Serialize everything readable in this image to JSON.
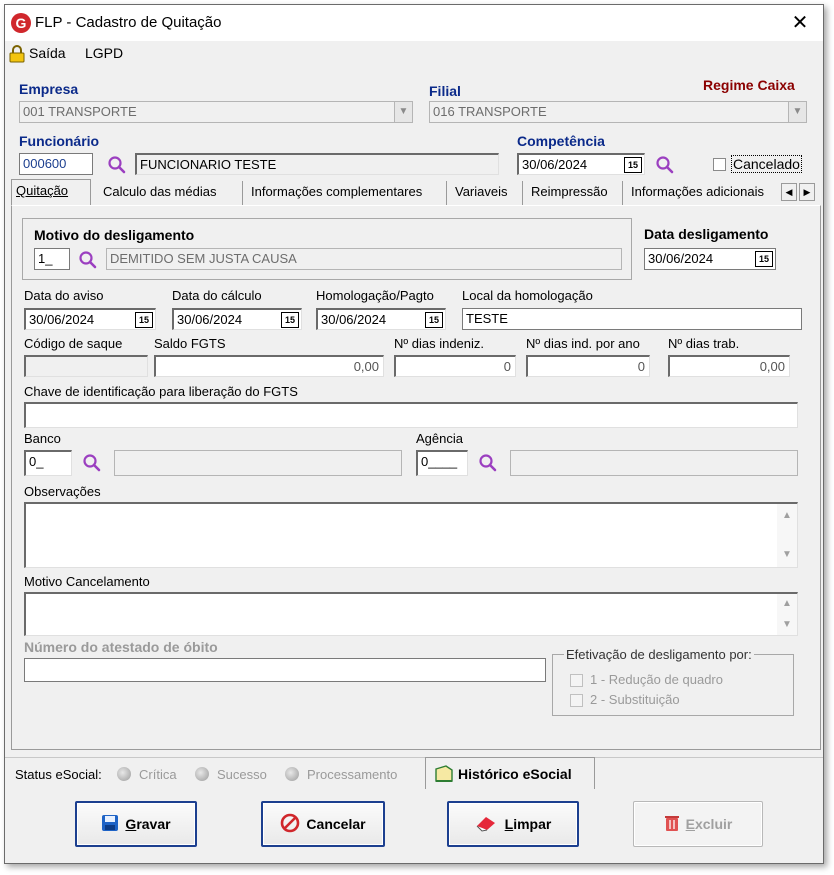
{
  "window": {
    "title": "FLP - Cadastro de Quitação",
    "logo_letter": "G",
    "close_glyph": "✕"
  },
  "menu": {
    "exit": "Saída",
    "lgpd": "LGPD"
  },
  "header": {
    "empresa_label": "Empresa",
    "empresa_value": "001 TRANSPORTE",
    "filial_label": "Filial",
    "filial_value": "016 TRANSPORTE",
    "regime_label": "Regime Caixa",
    "funcionario_label": "Funcionário",
    "funcionario_code": "000600",
    "funcionario_name": "FUNCIONARIO TESTE",
    "competencia_label": "Competência",
    "competencia_value": "30/06/2024",
    "cancelado_label": "Cancelado",
    "cancelado_checked": false
  },
  "tabs": [
    "Quitação",
    "Calculo das médias",
    "Informações complementares",
    "Variaveis",
    "Reimpressão",
    "Informações adicionais"
  ],
  "form": {
    "motivo_label": "Motivo do desligamento",
    "motivo_code": "1_",
    "motivo_desc": "DEMITIDO SEM JUSTA CAUSA",
    "data_deslig_label": "Data desligamento",
    "data_deslig_value": "30/06/2024",
    "data_aviso_label": "Data do aviso",
    "data_aviso_value": "30/06/2024",
    "data_calc_label": "Data do cálculo",
    "data_calc_value": "30/06/2024",
    "homolog_label": "Homologação/Pagto",
    "homolog_value": "30/06/2024",
    "local_homolog_label": "Local da homologação",
    "local_homolog_value": "TESTE",
    "cod_saque_label": "Código de saque",
    "cod_saque_value": "",
    "saldo_fgts_label": "Saldo FGTS",
    "saldo_fgts_value": "0,00",
    "dias_indeniz_label": "Nº dias indeniz.",
    "dias_indeniz_value": "0",
    "dias_ind_ano_label": "Nº dias ind. por ano",
    "dias_ind_ano_value": "0",
    "dias_trab_label": "Nº dias trab.",
    "dias_trab_value": "0,00",
    "chave_label": "Chave de identificação para liberação do FGTS",
    "chave_value": "",
    "banco_label": "Banco",
    "banco_code": "0_",
    "agencia_label": "Agência",
    "agencia_code": "0____",
    "observacoes_label": "Observações",
    "motivo_cancel_label": "Motivo Cancelamento",
    "atestado_label": "Número do atestado de óbito",
    "efetivacao_label": "Efetivação de desligamento por:",
    "opt1": "1 - Redução de quadro",
    "opt2": "2 - Substituição"
  },
  "status": {
    "label": "Status eSocial:",
    "critica": "Crítica",
    "sucesso": "Sucesso",
    "processamento": "Processamento",
    "historico": "Histórico eSocial"
  },
  "buttons": {
    "gravar_first": "G",
    "gravar_rest": "ravar",
    "cancelar": "Cancelar",
    "limpar_first": "L",
    "limpar_rest": "impar",
    "excluir_first": "E",
    "excluir_rest": "xcluir"
  },
  "calendar_glyph": "15",
  "colors": {
    "accent_blue": "#0b2a8a",
    "regime_red": "#8b0000",
    "search_purple": "#9b3fc0",
    "logo_red": "#d0272c"
  }
}
